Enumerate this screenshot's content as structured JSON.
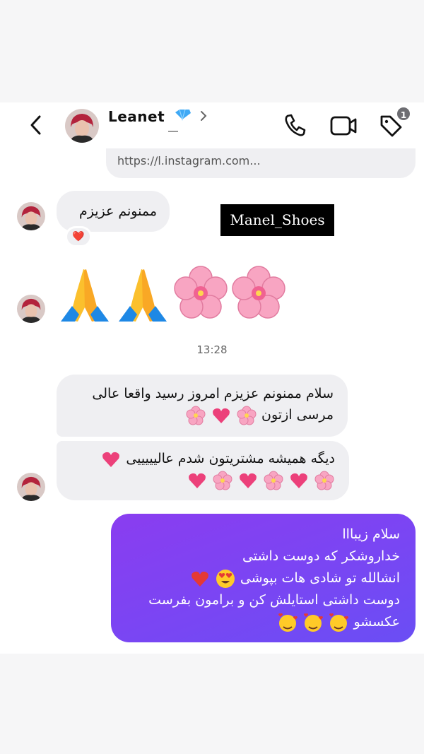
{
  "header": {
    "username": "Leanet",
    "badge_count": "1",
    "icons": [
      "back-arrow-icon",
      "verified-badge-icon",
      "chevron-right-icon",
      "phone-icon",
      "video-camera-icon",
      "tag-icon"
    ]
  },
  "link_preview": {
    "text": "https://l.instagram.com..."
  },
  "messages": {
    "m1": {
      "text": "ممنونم عزیزم",
      "reaction": "❤️"
    },
    "m2": {
      "emojis": [
        "🙏",
        "🙏",
        "🌸",
        "🌸"
      ]
    },
    "timestamp": "13:28",
    "m3": {
      "line1": "سلام ممنونم عزیزم امروز رسید واقعا عالی",
      "line2": "مرسی ازتون"
    },
    "m4": {
      "line1": "دیگه همیشه مشتریتون شدم عالیییییی"
    },
    "reply": {
      "line1": "سلام زیبااا",
      "line2": "خداروشکر که دوست داشتی",
      "line3": "انشالله تو شادی هات بپوشی",
      "line4": "دوست داشتی استایلش کن و برامون بفرست",
      "line5": "عکسشو"
    }
  },
  "watermark": {
    "text": "Manel_Shoes"
  },
  "colors": {
    "incoming_bubble": "#efeff2",
    "outgoing_bubble": "#7b45f3",
    "watermark_bg": "#000000"
  }
}
